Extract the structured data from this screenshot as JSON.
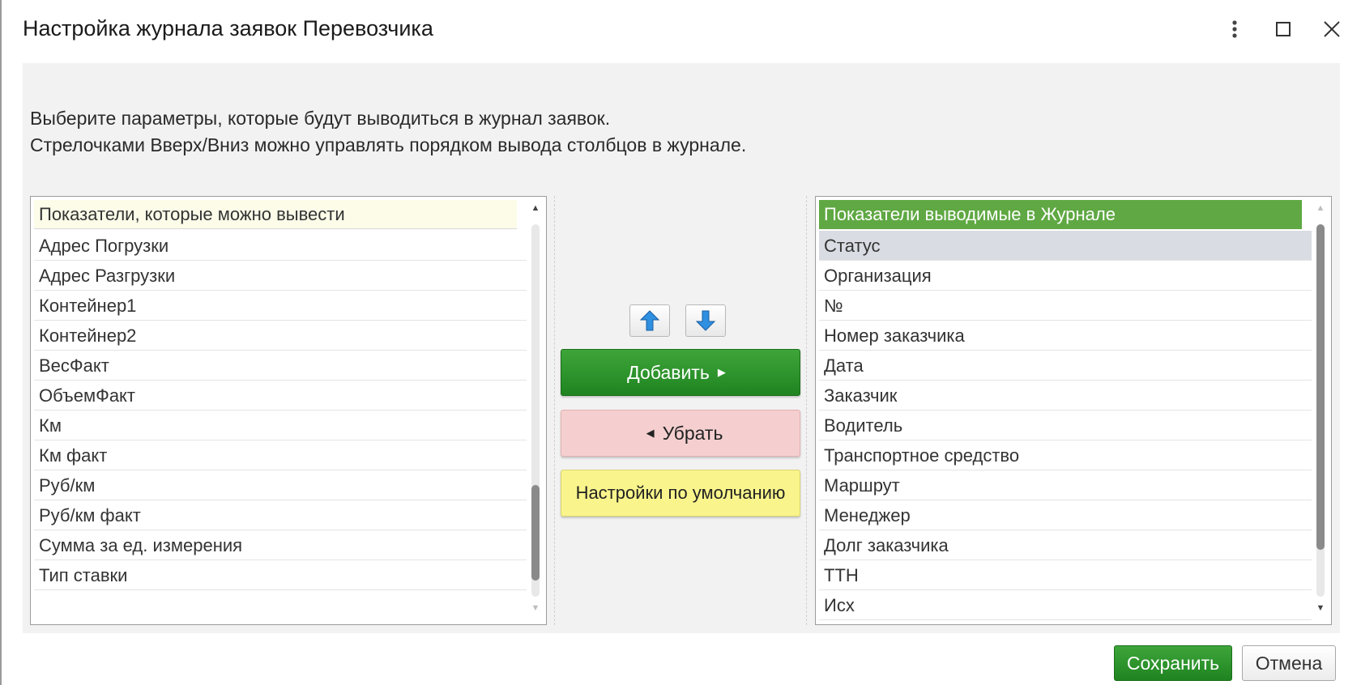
{
  "window": {
    "title": "Настройка журнала заявок Перевозчика"
  },
  "description": {
    "line1": "Выберите параметры, которые будут выводиться в журнал заявок.",
    "line2": "Стрелочками Вверх/Вниз можно управлять порядком вывода столбцов в журнале."
  },
  "available_list": {
    "header": "Показатели, которые можно вывести",
    "items": [
      "Адрес Погрузки",
      "Адрес Разгрузки",
      "Контейнер1",
      "Контейнер2",
      "ВесФакт",
      "ОбъемФакт",
      "Км",
      "Км факт",
      "Руб/км",
      "Руб/км факт",
      "Сумма за ед. измерения",
      "Тип ставки"
    ]
  },
  "selected_list": {
    "header": "Показатели выводимые в Журнале",
    "selected_index": 0,
    "items": [
      "Статус",
      "Организация",
      "№",
      "Номер заказчика",
      "Дата",
      "Заказчик",
      "Водитель",
      "Транспортное средство",
      "Маршрут",
      "Менеджер",
      "Долг заказчика",
      "ТТН",
      "Исх"
    ]
  },
  "actions": {
    "add_label": "Добавить",
    "remove_label": "Убрать",
    "defaults_label": "Настройки по умолчанию"
  },
  "footer": {
    "save_label": "Сохранить",
    "cancel_label": "Отмена"
  },
  "icons": {
    "move_up": "arrow-up-icon",
    "move_down": "arrow-down-icon",
    "kebab": "kebab-menu-icon",
    "maximize": "maximize-icon",
    "close": "close-icon"
  },
  "colors": {
    "accent_green": "#2e952d",
    "selected_header": "#5fa843",
    "remove_bg": "#f5cfcf",
    "defaults_bg": "#f9f58c",
    "arrow_blue": "#2f8fe0"
  }
}
